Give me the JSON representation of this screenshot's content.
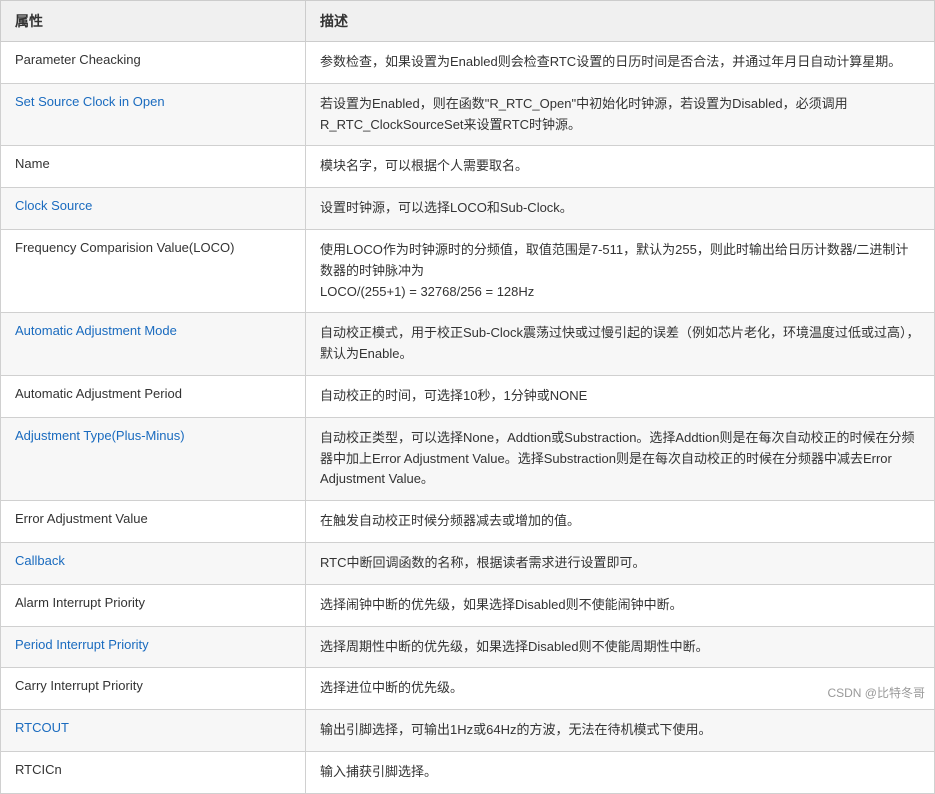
{
  "header": {
    "col1": "属性",
    "col2": "描述"
  },
  "rows": [
    {
      "id": "parameter-checking",
      "property": "Parameter Cheacking",
      "blue": false,
      "description": "参数检查，如果设置为Enabled则会检查RTC设置的日历时间是否合法，并通过年月日自动计算星期。"
    },
    {
      "id": "set-source-clock",
      "property": "Set Source Clock in Open",
      "blue": true,
      "description": "若设置为Enabled，则在函数\"R_RTC_Open\"中初始化时钟源，若设置为Disabled，必须调用R_RTC_ClockSourceSet来设置RTC时钟源。"
    },
    {
      "id": "name",
      "property": "Name",
      "blue": false,
      "description": "模块名字，可以根据个人需要取名。"
    },
    {
      "id": "clock-source",
      "property": "Clock Source",
      "blue": true,
      "description": "设置时钟源，可以选择LOCO和Sub-Clock。"
    },
    {
      "id": "frequency-comparison",
      "property": "Frequency Comparision Value(LOCO)",
      "blue": false,
      "description": "使用LOCO作为时钟源时的分频值，取值范围是7-511，默认为255，则此时输出给日历计数器/二进制计数器的时钟脉冲为\nLOCO/(255+1) = 32768/256 = 128Hz"
    },
    {
      "id": "automatic-adjustment-mode",
      "property": "Automatic Adjustment Mode",
      "blue": true,
      "description": "自动校正模式，用于校正Sub-Clock震荡过快或过慢引起的误差（例如芯片老化，环境温度过低或过高），默认为Enable。"
    },
    {
      "id": "automatic-adjustment-period",
      "property": "Automatic Adjustment Period",
      "blue": false,
      "description": "自动校正的时间，可选择10秒，1分钟或NONE"
    },
    {
      "id": "adjustment-type",
      "property": "Adjustment Type(Plus-Minus)",
      "blue": true,
      "description": "自动校正类型，可以选择None，Addtion或Substraction。选择Addtion则是在每次自动校正的时候在分频器中加上Error Adjustment Value。选择Substraction则是在每次自动校正的时候在分频器中减去Error Adjustment Value。"
    },
    {
      "id": "error-adjustment-value",
      "property": "Error Adjustment Value",
      "blue": false,
      "description": "在触发自动校正时候分频器减去或增加的值。"
    },
    {
      "id": "callback",
      "property": "Callback",
      "blue": true,
      "description": "RTC中断回调函数的名称，根据读者需求进行设置即可。"
    },
    {
      "id": "alarm-interrupt-priority",
      "property": "Alarm Interrupt Priority",
      "blue": false,
      "description": "选择闹钟中断的优先级，如果选择Disabled则不使能闹钟中断。"
    },
    {
      "id": "period-interrupt-priority",
      "property": "Period Interrupt Priority",
      "blue": true,
      "description": "选择周期性中断的优先级，如果选择Disabled则不使能周期性中断。"
    },
    {
      "id": "carry-interrupt-priority",
      "property": "Carry Interrupt Priority",
      "blue": false,
      "description": "选择进位中断的优先级。"
    },
    {
      "id": "rtcout",
      "property": "RTCOUT",
      "blue": true,
      "description": "输出引脚选择，可输出1Hz或64Hz的方波，无法在待机模式下使用。"
    },
    {
      "id": "rtcicn",
      "property": "RTCICn",
      "blue": false,
      "description": "输入捕获引脚选择。"
    }
  ],
  "watermark": "CSDN @比特冬哥"
}
